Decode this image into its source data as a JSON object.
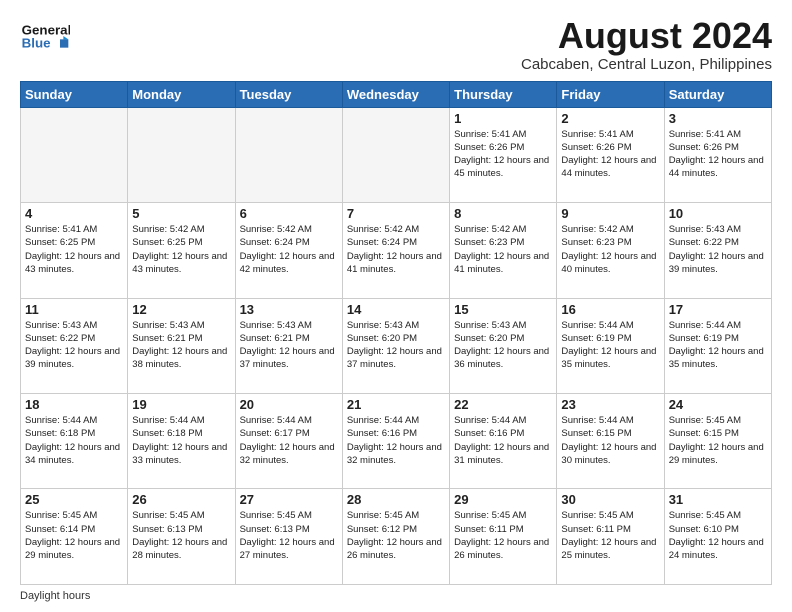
{
  "header": {
    "logo_general": "General",
    "logo_blue": "Blue",
    "title": "August 2024",
    "subtitle": "Cabcaben, Central Luzon, Philippines"
  },
  "days_of_week": [
    "Sunday",
    "Monday",
    "Tuesday",
    "Wednesday",
    "Thursday",
    "Friday",
    "Saturday"
  ],
  "weeks": [
    [
      {
        "day": "",
        "info": ""
      },
      {
        "day": "",
        "info": ""
      },
      {
        "day": "",
        "info": ""
      },
      {
        "day": "",
        "info": ""
      },
      {
        "day": "1",
        "info": "Sunrise: 5:41 AM\nSunset: 6:26 PM\nDaylight: 12 hours\nand 45 minutes."
      },
      {
        "day": "2",
        "info": "Sunrise: 5:41 AM\nSunset: 6:26 PM\nDaylight: 12 hours\nand 44 minutes."
      },
      {
        "day": "3",
        "info": "Sunrise: 5:41 AM\nSunset: 6:26 PM\nDaylight: 12 hours\nand 44 minutes."
      }
    ],
    [
      {
        "day": "4",
        "info": "Sunrise: 5:41 AM\nSunset: 6:25 PM\nDaylight: 12 hours\nand 43 minutes."
      },
      {
        "day": "5",
        "info": "Sunrise: 5:42 AM\nSunset: 6:25 PM\nDaylight: 12 hours\nand 43 minutes."
      },
      {
        "day": "6",
        "info": "Sunrise: 5:42 AM\nSunset: 6:24 PM\nDaylight: 12 hours\nand 42 minutes."
      },
      {
        "day": "7",
        "info": "Sunrise: 5:42 AM\nSunset: 6:24 PM\nDaylight: 12 hours\nand 41 minutes."
      },
      {
        "day": "8",
        "info": "Sunrise: 5:42 AM\nSunset: 6:23 PM\nDaylight: 12 hours\nand 41 minutes."
      },
      {
        "day": "9",
        "info": "Sunrise: 5:42 AM\nSunset: 6:23 PM\nDaylight: 12 hours\nand 40 minutes."
      },
      {
        "day": "10",
        "info": "Sunrise: 5:43 AM\nSunset: 6:22 PM\nDaylight: 12 hours\nand 39 minutes."
      }
    ],
    [
      {
        "day": "11",
        "info": "Sunrise: 5:43 AM\nSunset: 6:22 PM\nDaylight: 12 hours\nand 39 minutes."
      },
      {
        "day": "12",
        "info": "Sunrise: 5:43 AM\nSunset: 6:21 PM\nDaylight: 12 hours\nand 38 minutes."
      },
      {
        "day": "13",
        "info": "Sunrise: 5:43 AM\nSunset: 6:21 PM\nDaylight: 12 hours\nand 37 minutes."
      },
      {
        "day": "14",
        "info": "Sunrise: 5:43 AM\nSunset: 6:20 PM\nDaylight: 12 hours\nand 37 minutes."
      },
      {
        "day": "15",
        "info": "Sunrise: 5:43 AM\nSunset: 6:20 PM\nDaylight: 12 hours\nand 36 minutes."
      },
      {
        "day": "16",
        "info": "Sunrise: 5:44 AM\nSunset: 6:19 PM\nDaylight: 12 hours\nand 35 minutes."
      },
      {
        "day": "17",
        "info": "Sunrise: 5:44 AM\nSunset: 6:19 PM\nDaylight: 12 hours\nand 35 minutes."
      }
    ],
    [
      {
        "day": "18",
        "info": "Sunrise: 5:44 AM\nSunset: 6:18 PM\nDaylight: 12 hours\nand 34 minutes."
      },
      {
        "day": "19",
        "info": "Sunrise: 5:44 AM\nSunset: 6:18 PM\nDaylight: 12 hours\nand 33 minutes."
      },
      {
        "day": "20",
        "info": "Sunrise: 5:44 AM\nSunset: 6:17 PM\nDaylight: 12 hours\nand 32 minutes."
      },
      {
        "day": "21",
        "info": "Sunrise: 5:44 AM\nSunset: 6:16 PM\nDaylight: 12 hours\nand 32 minutes."
      },
      {
        "day": "22",
        "info": "Sunrise: 5:44 AM\nSunset: 6:16 PM\nDaylight: 12 hours\nand 31 minutes."
      },
      {
        "day": "23",
        "info": "Sunrise: 5:44 AM\nSunset: 6:15 PM\nDaylight: 12 hours\nand 30 minutes."
      },
      {
        "day": "24",
        "info": "Sunrise: 5:45 AM\nSunset: 6:15 PM\nDaylight: 12 hours\nand 29 minutes."
      }
    ],
    [
      {
        "day": "25",
        "info": "Sunrise: 5:45 AM\nSunset: 6:14 PM\nDaylight: 12 hours\nand 29 minutes."
      },
      {
        "day": "26",
        "info": "Sunrise: 5:45 AM\nSunset: 6:13 PM\nDaylight: 12 hours\nand 28 minutes."
      },
      {
        "day": "27",
        "info": "Sunrise: 5:45 AM\nSunset: 6:13 PM\nDaylight: 12 hours\nand 27 minutes."
      },
      {
        "day": "28",
        "info": "Sunrise: 5:45 AM\nSunset: 6:12 PM\nDaylight: 12 hours\nand 26 minutes."
      },
      {
        "day": "29",
        "info": "Sunrise: 5:45 AM\nSunset: 6:11 PM\nDaylight: 12 hours\nand 26 minutes."
      },
      {
        "day": "30",
        "info": "Sunrise: 5:45 AM\nSunset: 6:11 PM\nDaylight: 12 hours\nand 25 minutes."
      },
      {
        "day": "31",
        "info": "Sunrise: 5:45 AM\nSunset: 6:10 PM\nDaylight: 12 hours\nand 24 minutes."
      }
    ]
  ],
  "footer": {
    "daylight_label": "Daylight hours"
  }
}
